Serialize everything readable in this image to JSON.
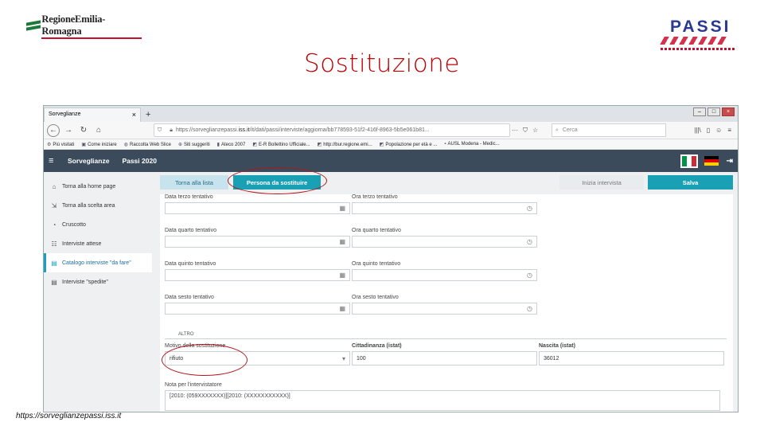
{
  "slide": {
    "brand_left": "RegioneEmilia-Romagna",
    "brand_right": "PASSI",
    "title": "Sostituzione",
    "footer_url": "https://sorveglianzepassi.iss.it"
  },
  "browser": {
    "tab_label": "Sorveglianze",
    "url_prefix": "https://sorveglianzepassi.",
    "url_domain": "iss.it",
    "url_path": "/it/dati/passi/interviste/aggiorna/bb778593-51f2-416f-8963-5b5e061b81...",
    "search_placeholder": "Cerca",
    "bookmarks": [
      "Più visitati",
      "Come iniziare",
      "Raccolta Web Slice",
      "Siti suggeriti",
      "Ateco 2007",
      "E-R Bollettino Ufficiale...",
      "http://bur.regione.emi...",
      "Popolazione per età e ...",
      "AUSL Modena - Medic..."
    ]
  },
  "app": {
    "header_title": "Sorveglianze",
    "header_subtitle": "Passi 2020",
    "sidebar": [
      {
        "label": "Torna alla home page",
        "icon": "home-icon"
      },
      {
        "label": "Torna alla scelta area",
        "icon": "exit-icon"
      },
      {
        "label": "Cruscotto",
        "icon": "dashboard-icon"
      },
      {
        "label": "Interviste attese",
        "icon": "list-icon"
      },
      {
        "label": "Catalogo interviste \"da fare\"",
        "icon": "clipboard-icon",
        "active": true
      },
      {
        "label": "Interviste \"spedite\"",
        "icon": "clipboard-check-icon"
      }
    ],
    "actions": {
      "torna": "Torna alla lista",
      "persona": "Persona da sostituire",
      "inizia": "Inizia intervista",
      "salva": "Salva"
    },
    "form": {
      "rows": [
        {
          "date_label": "Data terzo tentativo",
          "time_label": "Ora terzo tentativo"
        },
        {
          "date_label": "Data quarto tentativo",
          "time_label": "Ora quarto tentativo"
        },
        {
          "date_label": "Data quinto tentativo",
          "time_label": "Ora quinto tentativo"
        },
        {
          "date_label": "Data sesto tentativo",
          "time_label": "Ora sesto tentativo"
        }
      ],
      "section_label": "ALTRO",
      "motivo_label": "Motivo della sostituzione",
      "motivo_value": "rifiuto",
      "cittadinanza_label": "Cittadinanza (istat)",
      "cittadinanza_value": "100",
      "nascita_label": "Nascita (istat)",
      "nascita_value": "36012",
      "nota_label": "Nota per l'intervistatore",
      "nota_value": "[2010: (059XXXXXXX)][2010: (XXXXXXXXXXX)]"
    },
    "colors": {
      "header_bg": "#3b4b5c",
      "accent": "#1aa0b5",
      "highlight_oval": "#b0161b",
      "title_red": "#c00000"
    }
  }
}
